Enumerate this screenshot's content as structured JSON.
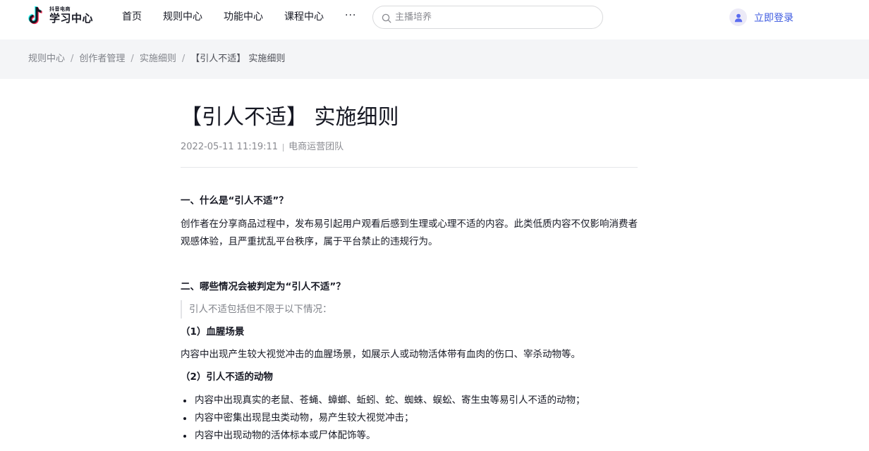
{
  "header": {
    "logo_small": "抖音电商",
    "logo_big": "学习中心",
    "nav": [
      "首页",
      "规则中心",
      "功能中心",
      "课程中心"
    ],
    "nav_more": "···",
    "search": {
      "placeholder": "主播培养"
    },
    "login_label": "立即登录"
  },
  "breadcrumb": {
    "items": [
      "规则中心",
      "创作者管理",
      "实施细则"
    ],
    "separator": "/",
    "current": "【引人不适】 实施细则"
  },
  "article": {
    "title": "【引人不适】 实施细则",
    "date": "2022-05-11 11:19:11",
    "author": "电商运营团队",
    "section1_heading": "一、什么是“引人不适”？",
    "section1_body": "创作者在分享商品过程中，发布易引起用户观看后感到生理或心理不适的内容。此类低质内容不仅影响消费者观感体验，且严重扰乱平台秩序，属于平台禁止的违规行为。",
    "section2_heading": "二、哪些情况会被判定为“引人不适”？",
    "section2_quote": "引人不适包括但不限于以下情况：",
    "sub1_heading": "（1）血腥场景",
    "sub1_body": "内容中出现产生较大视觉冲击的血腥场景，如展示人或动物活体带有血肉的伤口、宰杀动物等。",
    "sub2_heading": "（2）引人不适的动物",
    "sub2_bullets": [
      "内容中出现真实的老鼠、苍蝇、蟑螂、蚯蚓、蛇、蜘蛛、蜈蚣、寄生虫等易引人不适的动物；",
      "内容中密集出现昆虫类动物，易产生较大视觉冲击；",
      "内容中出现动物的活体标本或尸体配饰等。"
    ]
  },
  "colors": {
    "accent": "#3d5ae0",
    "text": "#161823",
    "muted": "#8a8b91",
    "breadcrumb_bg": "#f4f5f7"
  }
}
